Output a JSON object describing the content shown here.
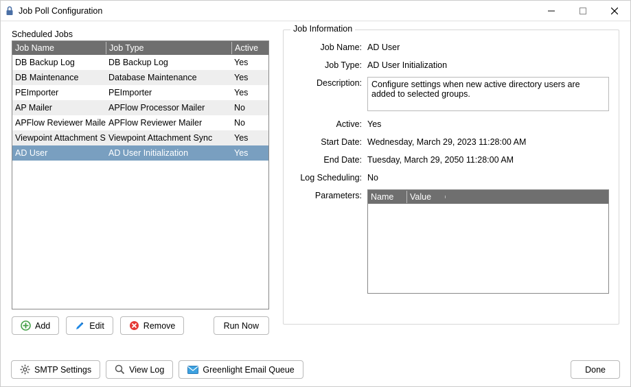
{
  "window": {
    "title": "Job Poll Configuration"
  },
  "left": {
    "label": "Scheduled Jobs",
    "columns": {
      "name": "Job Name",
      "type": "Job Type",
      "active": "Active"
    },
    "rows": [
      {
        "name": "DB Backup Log",
        "type": "DB Backup Log",
        "active": "Yes"
      },
      {
        "name": "DB Maintenance",
        "type": "Database Maintenance",
        "active": "Yes"
      },
      {
        "name": "PEImporter",
        "type": "PEImporter",
        "active": "Yes"
      },
      {
        "name": "AP Mailer",
        "type": "APFlow Processor Mailer",
        "active": "No"
      },
      {
        "name": "APFlow Reviewer Mailer",
        "type": "APFlow Reviewer Mailer",
        "active": "No"
      },
      {
        "name": "Viewpoint Attachment Sync",
        "type": "Viewpoint Attachment Sync",
        "active": "Yes"
      },
      {
        "name": "AD User",
        "type": "AD User Initialization",
        "active": "Yes"
      }
    ],
    "selected_index": 6,
    "buttons": {
      "add": "Add",
      "edit": "Edit",
      "remove": "Remove",
      "run_now": "Run Now"
    }
  },
  "info": {
    "group_title": "Job Information",
    "labels": {
      "job_name": "Job Name:",
      "job_type": "Job Type:",
      "description": "Description:",
      "active": "Active:",
      "start": "Start Date:",
      "end": "End Date:",
      "log_sched": "Log Scheduling:",
      "parameters": "Parameters:"
    },
    "values": {
      "job_name": "AD User",
      "job_type": "AD User Initialization",
      "description": "Configure settings when new active directory users are added to selected groups.",
      "active": "Yes",
      "start": "Wednesday, March 29, 2023 11:28:00 AM",
      "end": "Tuesday, March 29, 2050 11:28:00 AM",
      "log_sched": "No"
    },
    "param_columns": {
      "name": "Name",
      "value": "Value"
    }
  },
  "bottom": {
    "smtp": "SMTP Settings",
    "view_log": "View Log",
    "email_queue": "Greenlight Email Queue",
    "done": "Done"
  }
}
